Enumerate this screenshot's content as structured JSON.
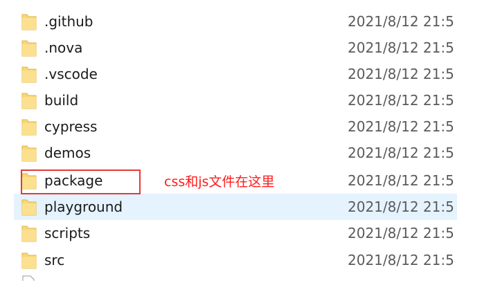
{
  "icons": {
    "folder": "folder-icon",
    "file": "file-icon"
  },
  "colors": {
    "folder_yellow": "#f8d775",
    "selection_bg": "#e5f3ff",
    "annotation_red": "#ff1a1a"
  },
  "files": [
    {
      "name": ".github",
      "modified": "2021/8/12 21:5"
    },
    {
      "name": ".nova",
      "modified": "2021/8/12 21:5"
    },
    {
      "name": ".vscode",
      "modified": "2021/8/12 21:5"
    },
    {
      "name": "build",
      "modified": "2021/8/12 21:5"
    },
    {
      "name": "cypress",
      "modified": "2021/8/12 21:5"
    },
    {
      "name": "demos",
      "modified": "2021/8/12 21:5"
    },
    {
      "name": "package",
      "modified": "2021/8/12 21:5"
    },
    {
      "name": "playground",
      "modified": "2021/8/12 21:5"
    },
    {
      "name": "scripts",
      "modified": "2021/8/12 21:5"
    },
    {
      "name": "src",
      "modified": "2021/8/12 21:5"
    }
  ],
  "annotation": {
    "text": "css和js文件在这里"
  }
}
